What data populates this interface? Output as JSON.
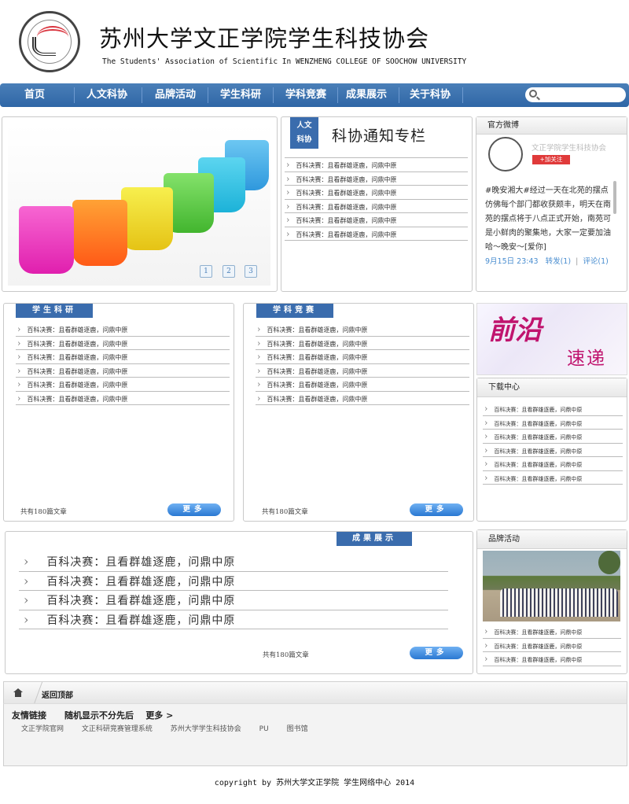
{
  "header": {
    "title": "苏州大学文正学院学生科技协会",
    "subtitle": "The Students' Association of Scientific In WENZHENG COLLEGE OF SOOCHOW UNIVERSITY"
  },
  "nav": [
    "首页",
    "人文科协",
    "品牌活动",
    "学生科研",
    "学科竞赛",
    "成果展示",
    "关于科协"
  ],
  "slider": {
    "pages": [
      "1",
      "2",
      "3"
    ]
  },
  "notice": {
    "tag_line1": "人文",
    "tag_line2": "科协",
    "title": "科协通知专栏",
    "items": [
      "百科决赛：且看群雄逐鹿，问鼎中原",
      "百科决赛：且看群雄逐鹿，问鼎中原",
      "百科决赛：且看群雄逐鹿，问鼎中原",
      "百科决赛：且看群雄逐鹿，问鼎中原",
      "百科决赛：且看群雄逐鹿，问鼎中原",
      "百科决赛：且看群雄逐鹿，问鼎中原"
    ]
  },
  "weibo": {
    "title": "官方微博",
    "name": "文正学院学生科技协会",
    "follow": "+加关注",
    "text": "#晚安湘大#经过一天在北苑的摆点仿佛每个部门都收获颇丰，明天在南苑的摆点将于八点正式开始，南苑可是小鲜肉的聚集地，大家一定要加油哈～晚安～[爱你]",
    "time": "9月15日 23:43",
    "repost": "转发(1)",
    "sep": "|",
    "comment": "评论(1)"
  },
  "research": {
    "tag": "学生科研",
    "items": [
      "百科决赛：且看群雄逐鹿，问鼎中原",
      "百科决赛：且看群雄逐鹿，问鼎中原",
      "百科决赛：且看群雄逐鹿，问鼎中原",
      "百科决赛：且看群雄逐鹿，问鼎中原",
      "百科决赛：且看群雄逐鹿，问鼎中原",
      "百科决赛：且看群雄逐鹿，问鼎中原"
    ],
    "count": "共有180篇文章",
    "more": "更多"
  },
  "competition": {
    "tag": "学科竞赛",
    "items": [
      "百科决赛：且看群雄逐鹿，问鼎中原",
      "百科决赛：且看群雄逐鹿，问鼎中原",
      "百科决赛：且看群雄逐鹿，问鼎中原",
      "百科决赛：且看群雄逐鹿，问鼎中原",
      "百科决赛：且看群雄逐鹿，问鼎中原",
      "百科决赛：且看群雄逐鹿，问鼎中原"
    ],
    "count": "共有180篇文章",
    "more": "更多"
  },
  "banner": {
    "big": "前沿",
    "small": "速递"
  },
  "downloads": {
    "title": "下载中心",
    "items": [
      "百科决赛：且看群雄逐鹿，问鼎中原",
      "百科决赛：且看群雄逐鹿，问鼎中原",
      "百科决赛：且看群雄逐鹿，问鼎中原",
      "百科决赛：且看群雄逐鹿，问鼎中原",
      "百科决赛：且看群雄逐鹿，问鼎中原",
      "百科决赛：且看群雄逐鹿，问鼎中原"
    ]
  },
  "achievements": {
    "tag": "成果展示",
    "items": [
      "百科决赛：且看群雄逐鹿，问鼎中原",
      "百科决赛：且看群雄逐鹿，问鼎中原",
      "百科决赛：且看群雄逐鹿，问鼎中原",
      "百科决赛：且看群雄逐鹿，问鼎中原"
    ],
    "count": "共有180篇文章",
    "more": "更多"
  },
  "brand": {
    "title": "品牌活动",
    "items": [
      "百科决赛：且看群雄逐鹿，问鼎中原",
      "百科决赛：且看群雄逐鹿，问鼎中原",
      "百科决赛：且看群雄逐鹿，问鼎中原"
    ]
  },
  "footer": {
    "back_top": "返回顶部",
    "links_label": "友情链接",
    "random_label": "随机显示不分先后",
    "more_label": "更多 >",
    "links": [
      "文正学院官网",
      "文正科研竞赛管理系统",
      "苏州大学学生科技协会",
      "PU",
      "图书馆"
    ],
    "copyright": "copyright by 苏州大学文正学院 学生网络中心 2014"
  },
  "colors": {
    "nav": "#3a6cad",
    "tag": "#3a6cad",
    "accent": "#c0146e"
  }
}
